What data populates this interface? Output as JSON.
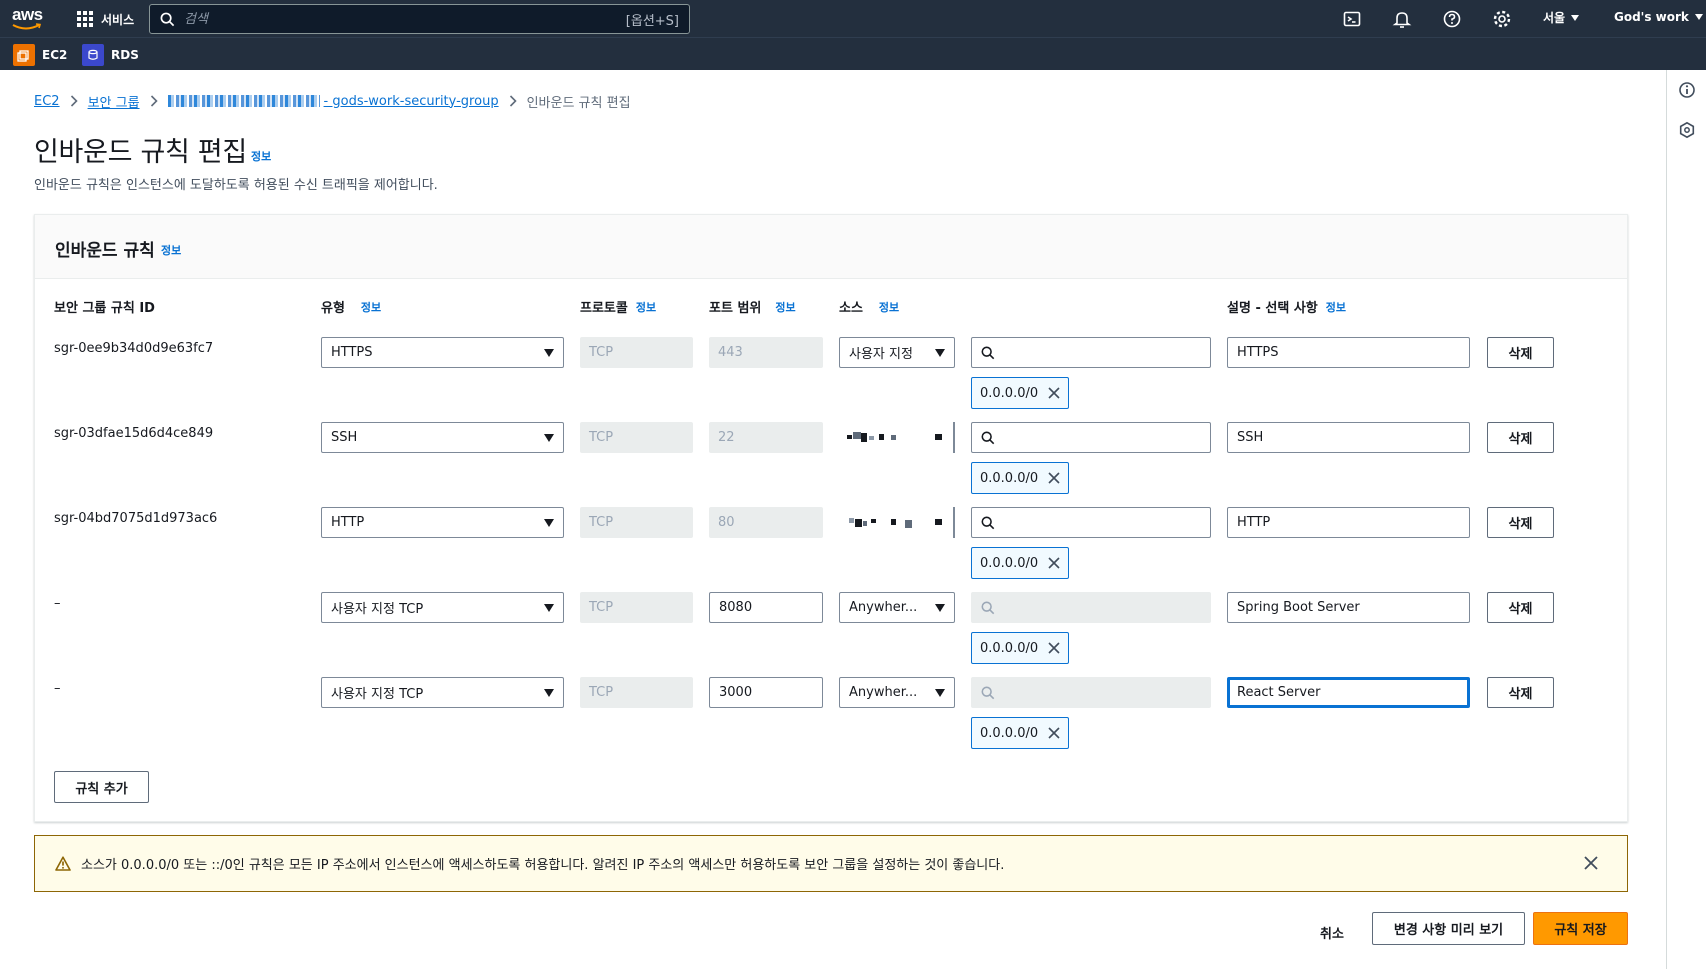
{
  "nav": {
    "logo_text": "aws",
    "services_label": "서비스",
    "search_placeholder": "검색",
    "search_shortcut": "[옵션+S]",
    "region": "서울",
    "account": "God's work"
  },
  "favorites": [
    {
      "label": "EC2",
      "color": "#ed7100"
    },
    {
      "label": "RDS",
      "color": "#3b48cc"
    }
  ],
  "breadcrumb": {
    "ec2": "EC2",
    "security_groups": "보안 그룹",
    "sg_name": "- gods-work-security-group",
    "current": "인바운드 규칙 편집"
  },
  "header": {
    "title": "인바운드 규칙 편집",
    "info": "정보",
    "description": "인바운드 규칙은 인스턴스에 도달하도록 허용된 수신 트래픽을 제어합니다."
  },
  "panel": {
    "title": "인바운드 규칙",
    "info": "정보"
  },
  "columns": {
    "rule_id": "보안 그룹 규칙 ID",
    "type": "유형",
    "protocol": "프로토콜",
    "port_range": "포트 범위",
    "source": "소스",
    "description": "설명 - 선택 사항",
    "info": "정보"
  },
  "rules": [
    {
      "id": "sgr-0ee9b34d0d9e63fc7",
      "type": "HTTPS",
      "protocol": "TCP",
      "port": "443",
      "source": "사용자 지정",
      "cidr": "0.0.0.0/0",
      "description": "HTTPS",
      "delete": "삭제"
    },
    {
      "id": "sgr-03dfae15d6d4ce849",
      "type": "SSH",
      "protocol": "TCP",
      "port": "22",
      "source": "",
      "cidr": "0.0.0.0/0",
      "description": "SSH",
      "delete": "삭제"
    },
    {
      "id": "sgr-04bd7075d1d973ac6",
      "type": "HTTP",
      "protocol": "TCP",
      "port": "80",
      "source": "",
      "cidr": "0.0.0.0/0",
      "description": "HTTP",
      "delete": "삭제"
    },
    {
      "id": "–",
      "type": "사용자 지정 TCP",
      "protocol": "TCP",
      "port": "8080",
      "source": "Anywher...",
      "cidr": "0.0.0.0/0",
      "description": "Spring Boot Server",
      "delete": "삭제"
    },
    {
      "id": "–",
      "type": "사용자 지정 TCP",
      "protocol": "TCP",
      "port": "3000",
      "source": "Anywher...",
      "cidr": "0.0.0.0/0",
      "description": "React Server",
      "delete": "삭제"
    }
  ],
  "add_rule": "규칙 추가",
  "warning": "소스가 0.0.0.0/0 또는 ::/0인 규칙은 모든 IP 주소에서 인스턴스에 액세스하도록 허용합니다. 알려진 IP 주소의 액세스만 허용하도록 보안 그룹을 설정하는 것이 좋습니다.",
  "footer": {
    "cancel": "취소",
    "preview": "변경 사항 미리 보기",
    "save": "규칙 저장"
  },
  "colors": {
    "nav_bg": "#232f3e",
    "link": "#0972d3",
    "primary_button": "#ff9900",
    "warning_bg": "#fffce9",
    "warning_border": "#8d6605"
  }
}
